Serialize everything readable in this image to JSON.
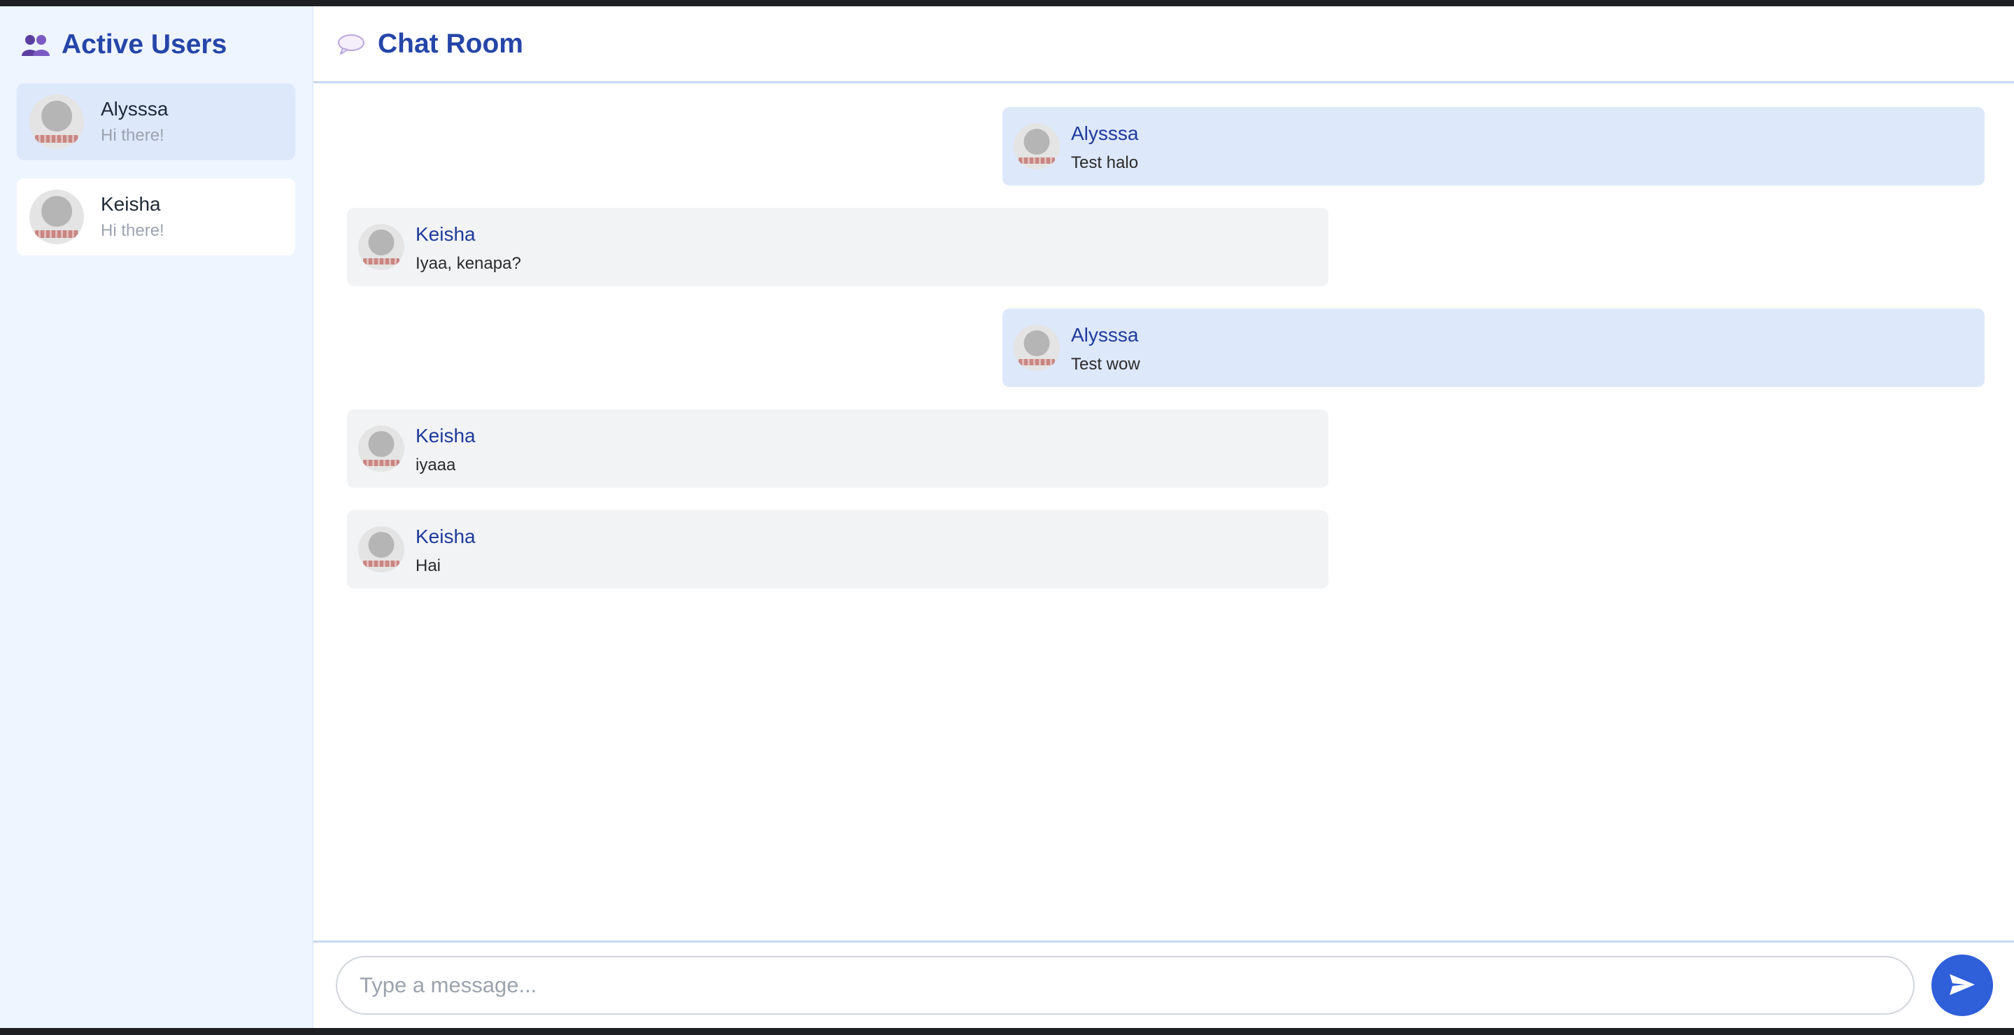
{
  "sidebar": {
    "title": "Active Users",
    "title_icon": "users-icon",
    "users": [
      {
        "name": "Alysssa",
        "status": "Hi there!",
        "active": true
      },
      {
        "name": "Keisha",
        "status": "Hi there!",
        "active": false
      }
    ]
  },
  "header": {
    "title": "Chat Room",
    "icon": "speech-bubble-icon"
  },
  "messages": [
    {
      "sender": "Alysssa",
      "text": "Test halo",
      "side": "mine"
    },
    {
      "sender": "Keisha",
      "text": "Iyaa, kenapa?",
      "side": "theirs"
    },
    {
      "sender": "Alysssa",
      "text": "Test wow",
      "side": "mine"
    },
    {
      "sender": "Keisha",
      "text": "iyaaa",
      "side": "theirs"
    },
    {
      "sender": "Keisha",
      "text": "Hai",
      "side": "theirs"
    }
  ],
  "composer": {
    "placeholder": "Type a message...",
    "value": "",
    "send_icon": "send-icon"
  },
  "colors": {
    "accent": "#2f5fd9",
    "title": "#2545a8",
    "sidebar_bg": "#eef5ff",
    "mine_bubble": "#dde8fb",
    "theirs_bubble": "#f2f3f5"
  }
}
